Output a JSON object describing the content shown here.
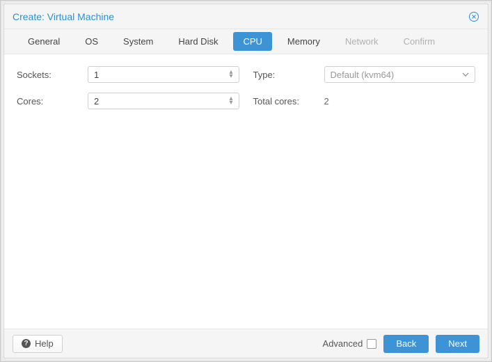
{
  "title": "Create: Virtual Machine",
  "tabs": [
    {
      "label": "General",
      "state": "normal"
    },
    {
      "label": "OS",
      "state": "normal"
    },
    {
      "label": "System",
      "state": "normal"
    },
    {
      "label": "Hard Disk",
      "state": "normal"
    },
    {
      "label": "CPU",
      "state": "active"
    },
    {
      "label": "Memory",
      "state": "normal"
    },
    {
      "label": "Network",
      "state": "disabled"
    },
    {
      "label": "Confirm",
      "state": "disabled"
    }
  ],
  "form": {
    "sockets": {
      "label": "Sockets:",
      "value": "1"
    },
    "cores": {
      "label": "Cores:",
      "value": "2"
    },
    "type": {
      "label": "Type:",
      "value": "Default (kvm64)"
    },
    "total_cores": {
      "label": "Total cores:",
      "value": "2"
    }
  },
  "footer": {
    "help": "Help",
    "advanced": "Advanced",
    "advanced_checked": false,
    "back": "Back",
    "next": "Next"
  }
}
